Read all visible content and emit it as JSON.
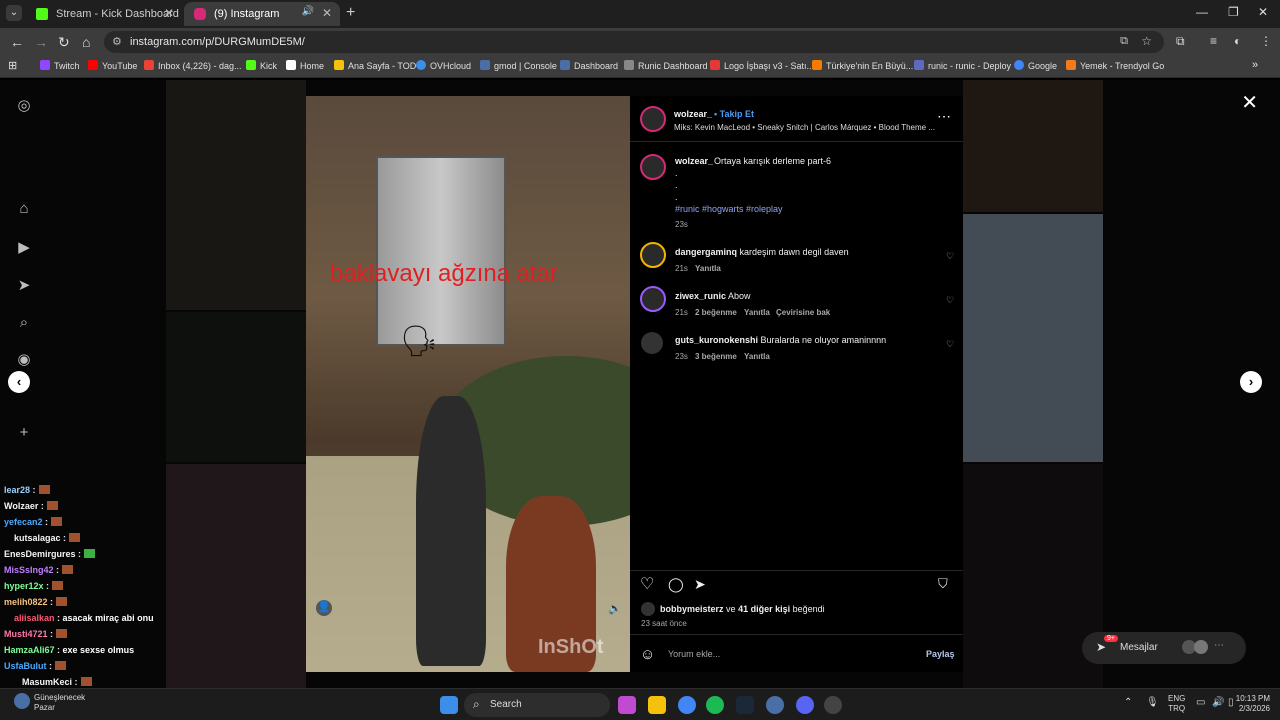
{
  "browser": {
    "tabs": [
      {
        "title": "Stream - Kick Dashboard",
        "favicon_color": "#53fc18"
      },
      {
        "title": "(9) Instagram",
        "favicon_color": "#d62976"
      }
    ],
    "url": "instagram.com/p/DURGMumDE5M/",
    "bookmarks": [
      {
        "label": "Twitch",
        "color": "#9146ff"
      },
      {
        "label": "YouTube",
        "color": "#ff0000"
      },
      {
        "label": "Inbox (4,226) - dag...",
        "color": "#ea4335"
      },
      {
        "label": "Kick",
        "color": "#53fc18"
      },
      {
        "label": "Home",
        "color": "#ffffff"
      },
      {
        "label": "Ana Sayfa - TOD",
        "color": "#f4c20d"
      },
      {
        "label": "OVHcloud",
        "color": "#3b8fe8"
      },
      {
        "label": "gmod | Console",
        "color": "#4a6fa5"
      },
      {
        "label": "Dashboard",
        "color": "#4a6fa5"
      },
      {
        "label": "Runic Dashboard",
        "color": "#888888"
      },
      {
        "label": "Logo İşbaşı v3 - Satı...",
        "color": "#e53935"
      },
      {
        "label": "Türkiye'nin En Büyü...",
        "color": "#f57c00"
      },
      {
        "label": "runic - runic - Deploy",
        "color": "#5c6bc0"
      },
      {
        "label": "Google",
        "color": "#4285f4"
      },
      {
        "label": "Yemek - Trendyol Go",
        "color": "#f27a1a"
      }
    ]
  },
  "chat": [
    {
      "user": "lear28",
      "msg": "",
      "color": "#9ad1ff"
    },
    {
      "user": "Wolzaer",
      "msg": "",
      "color": "#f5f5f5"
    },
    {
      "user": "yefecan2",
      "msg": "",
      "color": "#4aa8ff"
    },
    {
      "user": "kutsalagac",
      "msg": "",
      "color": "#f5f5f5"
    },
    {
      "user": "EnesDemirgures",
      "msg": "",
      "color": "#f5f5f5"
    },
    {
      "user": "MisSsIng42",
      "msg": "",
      "color": "#c27cff"
    },
    {
      "user": "hyper12x",
      "msg": "",
      "color": "#7cff9a"
    },
    {
      "user": "melih0822",
      "msg": "",
      "color": "#f5c27c"
    },
    {
      "user": "aliisalkan",
      "msg": "asacak miraç abi onu",
      "color": "#ff5577"
    },
    {
      "user": "Musti4721",
      "msg": "",
      "color": "#ff77aa"
    },
    {
      "user": "HamzaAli67",
      "msg": "exe sexse olmus",
      "color": "#7cff9a"
    },
    {
      "user": "UsfaBulut",
      "msg": "",
      "color": "#4aa8ff"
    },
    {
      "user": "MasumKeci",
      "msg": "",
      "color": "#f5f5f5"
    }
  ],
  "video": {
    "caption_overlay": "baklavayı ağzına atar",
    "watermark": "InShOt"
  },
  "post": {
    "author": "wolzear_",
    "follow_label": "Takip Et",
    "dot": "•",
    "music": "Miks: Kevin MacLeod • Sneaky Snitch | Carlos Márquez • Blood Theme ...",
    "caption_user": "wolzear_",
    "caption_text": "Ortaya karışık derleme part-6",
    "caption_dots": ".",
    "hashtags": "#runic #hogwarts #roleplay",
    "caption_time": "23s",
    "comments": [
      {
        "user": "dangergaminq",
        "text": "kardeşim dawn degil daven",
        "time": "21s",
        "likes": "",
        "reply": "Yanıtla",
        "translate": ""
      },
      {
        "user": "ziwex_runic",
        "text": "Abow",
        "time": "21s",
        "likes": "2 beğenme",
        "reply": "Yanıtla",
        "translate": "Çevirisine bak"
      },
      {
        "user": "guts_kuronokenshi",
        "text": "Buralarda ne oluyor amaninnnn",
        "time": "23s",
        "likes": "3 beğenme",
        "reply": "Yanıtla",
        "translate": ""
      }
    ],
    "liked_by_user": "bobbymeisterz",
    "liked_by_mid": "ve",
    "liked_by_count": "41 diğer kişi",
    "liked_by_suffix": "beğendi",
    "post_time": "23 saat önce",
    "comment_placeholder": "Yorum ekle...",
    "share_label": "Paylaş"
  },
  "messages": {
    "label": "Mesajlar",
    "badge": "9+"
  },
  "taskbar": {
    "search_label": "Search",
    "weather_line1": "Güneşlenecek",
    "weather_line2": "Pazar",
    "lang_line1": "ENG",
    "lang_line2": "TRQ",
    "time": "10:13 PM",
    "date": "2/3/2026"
  },
  "icons": {
    "heart": "♡",
    "comment": "◯",
    "send": "➤",
    "bookmark": "🔖",
    "more": "⋯",
    "emoji": "☺",
    "close": "✕",
    "prev": "‹",
    "next": "›"
  }
}
